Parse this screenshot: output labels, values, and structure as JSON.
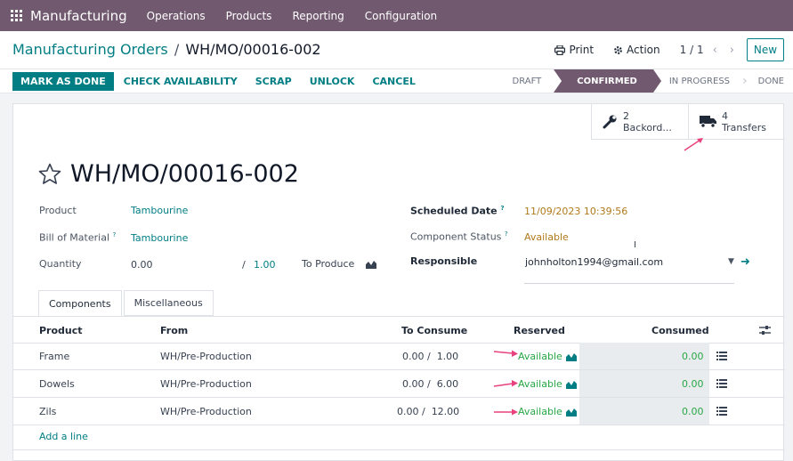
{
  "app": {
    "name": "Manufacturing",
    "menu": [
      "Operations",
      "Products",
      "Reporting",
      "Configuration"
    ]
  },
  "control_panel": {
    "breadcrumb_parent": "Manufacturing Orders",
    "breadcrumb_sep": "/",
    "breadcrumb_current": "WH/MO/00016-002",
    "print_label": "Print",
    "action_label": "Action",
    "pager": "1 / 1",
    "new_label": "New"
  },
  "status_bar": {
    "buttons": [
      "MARK AS DONE",
      "CHECK AVAILABILITY",
      "SCRAP",
      "UNLOCK",
      "CANCEL"
    ],
    "stages": [
      "DRAFT",
      "CONFIRMED",
      "IN PROGRESS",
      "DONE"
    ],
    "active_stage": "CONFIRMED"
  },
  "smart_buttons": [
    {
      "count": "2",
      "label": "Backord...",
      "icon": "wrench-icon"
    },
    {
      "count": "4",
      "label": "Transfers",
      "icon": "truck-icon"
    }
  ],
  "form": {
    "title": "WH/MO/00016-002",
    "product_label": "Product",
    "product_value": "Tambourine",
    "bom_label": "Bill of Material",
    "bom_value": "Tambourine",
    "quantity_label": "Quantity",
    "quantity_value": "0.00",
    "quantity_sep": "/",
    "quantity_target": "1.00",
    "to_produce_label": "To Produce",
    "scheduled_label": "Scheduled Date",
    "scheduled_value": "11/09/2023 10:39:56",
    "component_status_label": "Component Status",
    "component_status_value": "Available",
    "responsible_label": "Responsible",
    "responsible_value": "johnholton1994@gmail.com",
    "help_mark": "?"
  },
  "tabs": [
    "Components",
    "Miscellaneous"
  ],
  "table": {
    "headers": {
      "product": "Product",
      "from": "From",
      "to_consume": "To Consume",
      "reserved": "Reserved",
      "consumed": "Consumed"
    },
    "rows": [
      {
        "product": "Frame",
        "from": "WH/Pre-Production",
        "to_consume": "0.00 /  1.00",
        "reserved": "Available",
        "consumed": "0.00"
      },
      {
        "product": "Dowels",
        "from": "WH/Pre-Production",
        "to_consume": "0.00 /  6.00",
        "reserved": "Available",
        "consumed": "0.00"
      },
      {
        "product": "Zils",
        "from": "WH/Pre-Production",
        "to_consume": "0.00 /  12.00",
        "reserved": "Available",
        "consumed": "0.00"
      }
    ],
    "add_line": "Add a line"
  },
  "colors": {
    "brand": "#71596f",
    "accent": "#017e84",
    "available": "#28a745",
    "annotation": "#e8417d"
  }
}
